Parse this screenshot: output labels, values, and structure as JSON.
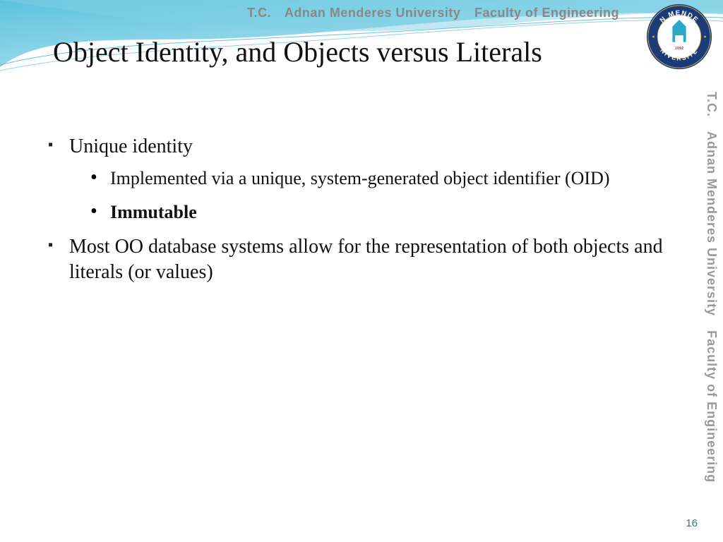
{
  "header": {
    "tc": "T.C.",
    "university": "Adnan Menderes University",
    "faculty": "Faculty of Engineering"
  },
  "logo": {
    "outer_text_top": "MENDERES",
    "outer_text_left": "ADNAN",
    "outer_text_bottom": "ÜNİVERSİTESİ",
    "year": "1992"
  },
  "vertical": {
    "tc": "T.C.",
    "university": "Adnan Menderes University",
    "faculty": "Faculty of Engineering"
  },
  "title": "Object Identity, and Objects versus Literals",
  "bullets": {
    "b1": "Unique identity",
    "b1_1": "Implemented via a unique, system-generated object identifier (OID)",
    "b1_2": "Immutable",
    "b2": "Most OO database systems allow for the representation of both objects and literals (or values)"
  },
  "page_number": "16"
}
